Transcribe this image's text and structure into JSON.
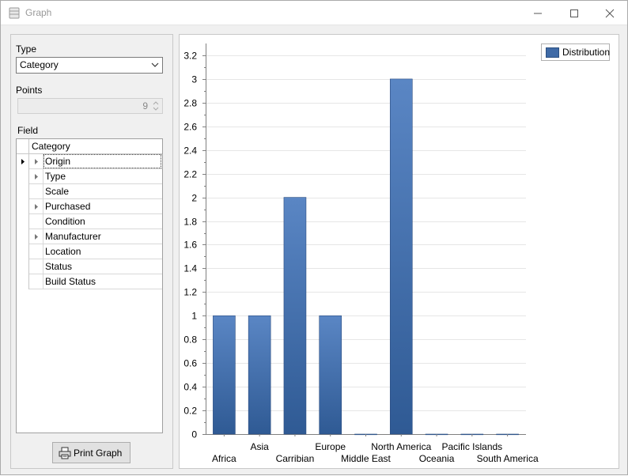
{
  "window": {
    "title": "Graph",
    "icon": "database-icon"
  },
  "controls": {
    "type_label": "Type",
    "type_value": "Category",
    "points_label": "Points",
    "points_value": "9",
    "field_label": "Field",
    "print_label": "Print Graph"
  },
  "field_grid": {
    "header": "Category",
    "rows": [
      {
        "label": "Origin",
        "expandable": true,
        "selected": true
      },
      {
        "label": "Type",
        "expandable": true
      },
      {
        "label": "Scale",
        "expandable": false
      },
      {
        "label": "Purchased",
        "expandable": true
      },
      {
        "label": "Condition",
        "expandable": false
      },
      {
        "label": "Manufacturer",
        "expandable": true
      },
      {
        "label": "Location",
        "expandable": false
      },
      {
        "label": "Status",
        "expandable": false
      },
      {
        "label": "Build Status",
        "expandable": false
      }
    ]
  },
  "colors": {
    "bar_top": "#5a86c4",
    "bar_bottom": "#2f5a94",
    "grid": "#e6e6e6",
    "axis": "#808080"
  },
  "chart_data": {
    "type": "bar",
    "categories": [
      "Africa",
      "Asia",
      "Carribian",
      "Europe",
      "Middle East",
      "North America",
      "Oceania",
      "Pacific Islands",
      "South America"
    ],
    "series": [
      {
        "name": "Distribution",
        "values": [
          1,
          1,
          2,
          1,
          0,
          3,
          0,
          0,
          0
        ]
      }
    ],
    "ylim": [
      0,
      3.3
    ],
    "yticks": [
      "0",
      "0.2",
      "0.4",
      "0.6",
      "0.8",
      "1",
      "1.2",
      "1.4",
      "1.6",
      "1.8",
      "2",
      "2.2",
      "2.4",
      "2.6",
      "2.8",
      "3",
      "3.2"
    ],
    "grid": true,
    "legend": "top-right"
  }
}
